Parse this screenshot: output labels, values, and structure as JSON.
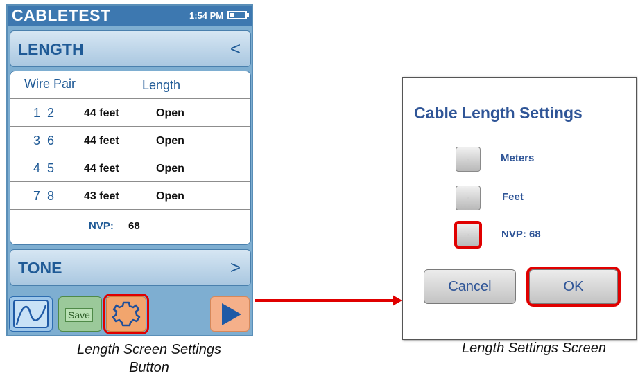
{
  "device": {
    "app_title": "CABLETEST",
    "time": "1:54 PM",
    "length_section": {
      "title": "LENGTH",
      "chevron": "<"
    },
    "table": {
      "headers": {
        "pair": "Wire Pair",
        "length": "Length"
      },
      "rows": [
        {
          "pair_a": "1",
          "pair_b": "2",
          "length": "44 feet",
          "status": "Open"
        },
        {
          "pair_a": "3",
          "pair_b": "6",
          "length": "44 feet",
          "status": "Open"
        },
        {
          "pair_a": "4",
          "pair_b": "5",
          "length": "44 feet",
          "status": "Open"
        },
        {
          "pair_a": "7",
          "pair_b": "8",
          "length": "43 feet",
          "status": "Open"
        }
      ],
      "nvp_label": "NVP:",
      "nvp_value": "68"
    },
    "tone_section": {
      "title": "TONE",
      "chevron": ">"
    },
    "toolbar": {
      "graph_icon": "graph-icon",
      "save_label": "Save",
      "settings_icon": "gear-icon",
      "play_icon": "play-icon"
    }
  },
  "dialog": {
    "title": "Cable Length Settings",
    "options": [
      {
        "label": "Meters"
      },
      {
        "label": "Feet"
      },
      {
        "label": "NVP: 68"
      }
    ],
    "cancel_label": "Cancel",
    "ok_label": "OK"
  },
  "captions": {
    "left": "Length Screen Settings Button",
    "right": "Length Settings Screen"
  },
  "colors": {
    "highlight": "#e00000",
    "accent_blue": "#1f5a96",
    "device_bg": "#7eaed1"
  }
}
